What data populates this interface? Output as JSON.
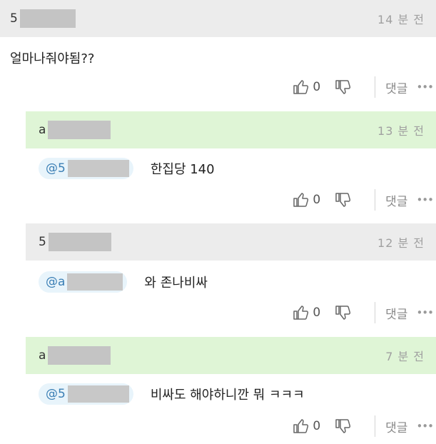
{
  "comments": [
    {
      "user_initial": "5",
      "time": "14 분 전",
      "text": "얼마나줘야됨??",
      "likes": "0",
      "reply_label": "댓글",
      "more": "•••"
    },
    {
      "user_initial": "a",
      "time": "13 분 전",
      "mention": "@5",
      "text": "한집당 140",
      "likes": "0",
      "reply_label": "댓글",
      "more": "•••"
    },
    {
      "user_initial": "5",
      "time": "12 분 전",
      "mention": "@a",
      "text": "와 존나비싸",
      "likes": "0",
      "reply_label": "댓글",
      "more": "•••"
    },
    {
      "user_initial": "a",
      "time": "7 분 전",
      "mention": "@5",
      "text": "비싸도 해야하니깐 뭐 ㅋㅋㅋ",
      "likes": "0",
      "reply_label": "댓글",
      "more": "•••"
    }
  ],
  "icons": {
    "like": "thumbs-up-icon",
    "dislike": "thumbs-down-icon",
    "more": "more-icon"
  },
  "colors": {
    "gray_header": "#ececec",
    "green_header": "#dff5d6",
    "mention_text": "#3b7fb5"
  }
}
